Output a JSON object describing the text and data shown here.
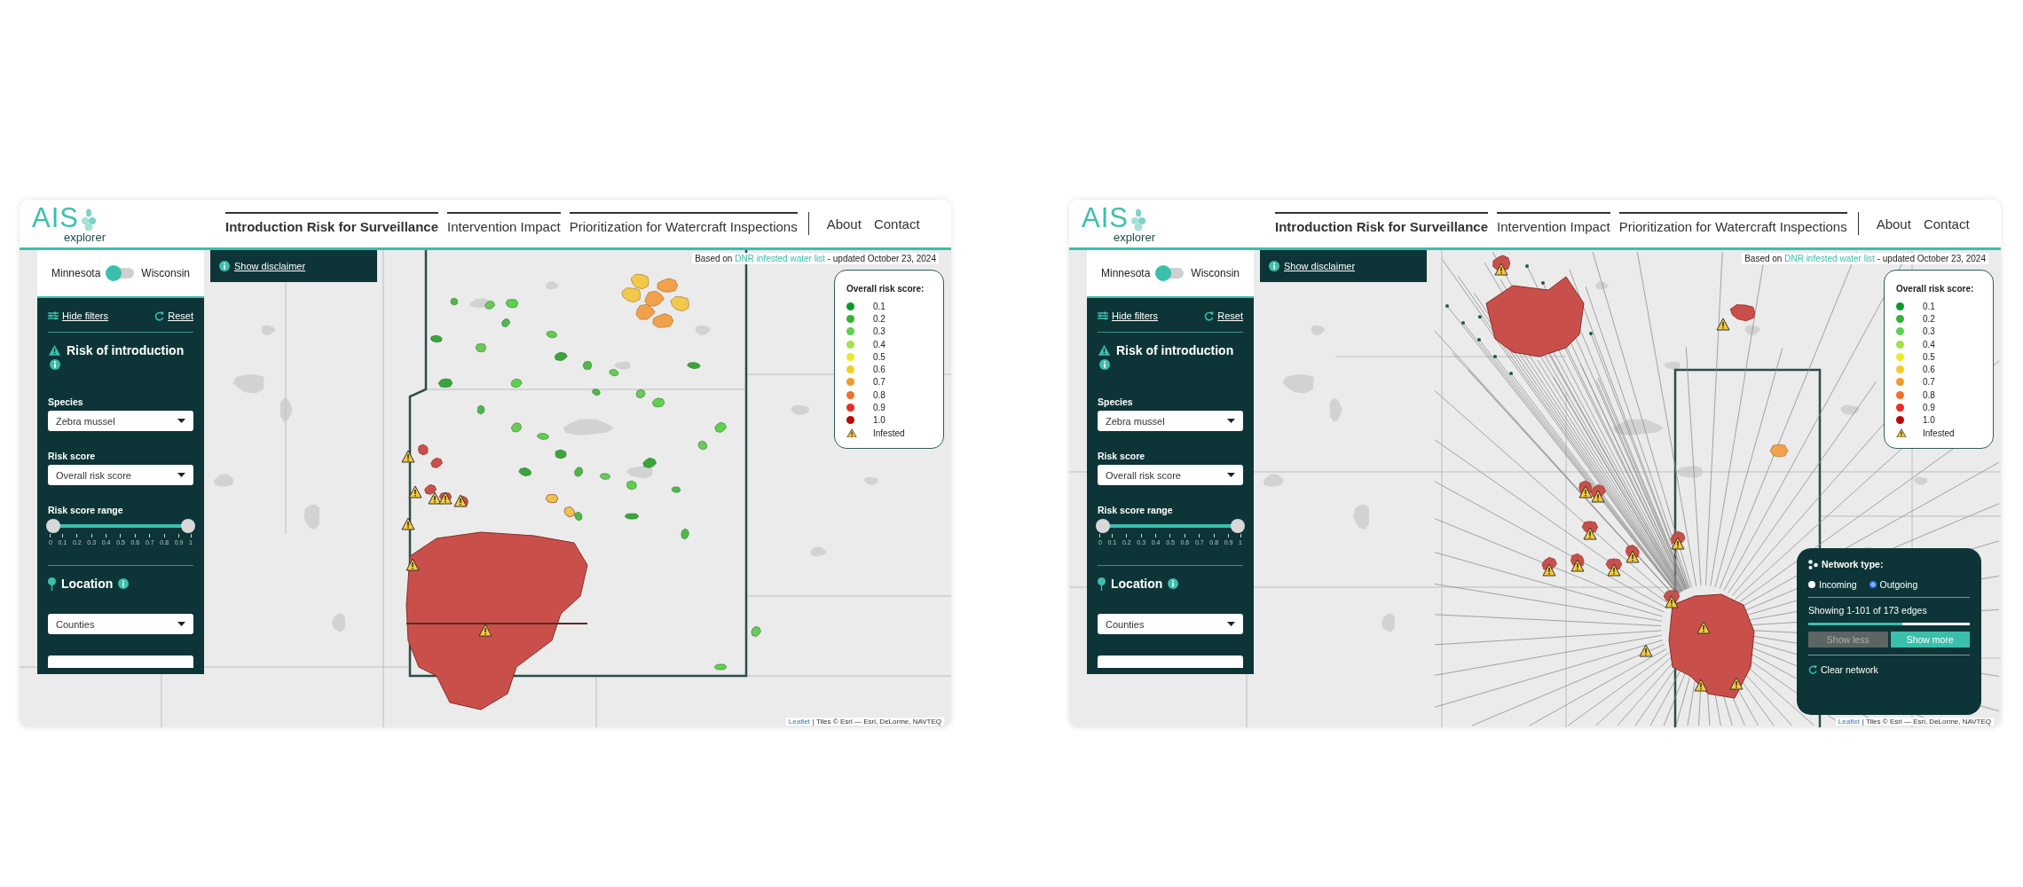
{
  "windows": [
    {
      "logo": {
        "title": "AIS",
        "subtitle": "explorer"
      },
      "nav": [
        {
          "label": "Introduction Risk for Surveillance",
          "selected": true
        },
        {
          "label": "Intervention Impact",
          "selected": false
        },
        {
          "label": "Prioritization for Watercraft Inspections",
          "selected": false
        }
      ],
      "links": [
        "About",
        "Contact"
      ],
      "state_toggle": {
        "left": "Minnesota",
        "right": "Wisconsin",
        "right_selected": false
      },
      "disclaimer": "Show disclaimer",
      "source": {
        "prefix": "Based on ",
        "link": "DNR infested water list",
        "suffix": " - updated October 23, 2024"
      },
      "filters": {
        "hide": "Hide filters",
        "reset": "Reset",
        "title": "Risk of introduction",
        "fields": [
          {
            "label": "Species",
            "value": "Zebra mussel"
          },
          {
            "label": "Risk score",
            "value": "Overall risk score"
          }
        ],
        "range": {
          "label": "Risk score range",
          "thumbs": [
            {
              "level": 0
            },
            {
              "level": 1
            }
          ],
          "ticks": [
            "0",
            "0.1",
            "0.2",
            "0.3",
            "0.4",
            "0.5",
            "0.6",
            "0.7",
            "0.8",
            "0.9",
            "1"
          ]
        },
        "location": {
          "title": "Location",
          "value": "Counties"
        }
      },
      "map": {
        "kind": "risk"
      },
      "legend": {
        "title": "Overall risk score:",
        "items": [
          {
            "kind": "score",
            "label": "0.1",
            "color": "#089c2c"
          },
          {
            "kind": "score",
            "label": "0.2",
            "color": "#35b233"
          },
          {
            "kind": "score",
            "label": "0.3",
            "color": "#5fcf4f"
          },
          {
            "kind": "score",
            "label": "0.4",
            "color": "#a3e04a"
          },
          {
            "kind": "score",
            "label": "0.5",
            "color": "#ece82a"
          },
          {
            "kind": "score",
            "label": "0.6",
            "color": "#f0cd2a"
          },
          {
            "kind": "score",
            "label": "0.7",
            "color": "#f29a2a"
          },
          {
            "kind": "score",
            "label": "0.8",
            "color": "#f0702a"
          },
          {
            "kind": "score",
            "label": "0.9",
            "color": "#ee2a2a"
          },
          {
            "kind": "score",
            "label": "1.0",
            "color": "#b80808"
          },
          {
            "kind": "infested",
            "label": "Infested"
          }
        ]
      },
      "attribution": {
        "link": "Leaflet",
        "text": "| Tiles © Esri — Esri, DeLorme, NAVTEQ"
      }
    },
    {
      "logo": {
        "title": "AIS",
        "subtitle": "explorer"
      },
      "nav": [
        {
          "label": "Introduction Risk for Surveillance",
          "selected": true
        },
        {
          "label": "Intervention Impact",
          "selected": false
        },
        {
          "label": "Prioritization for Watercraft Inspections",
          "selected": false
        }
      ],
      "links": [
        "About",
        "Contact"
      ],
      "state_toggle": {
        "left": "Minnesota",
        "right": "Wisconsin",
        "right_selected": false
      },
      "disclaimer": "Show disclaimer",
      "source": {
        "prefix": "Based on ",
        "link": "DNR infested water list",
        "suffix": " - updated October 23, 2024"
      },
      "filters": {
        "hide": "Hide filters",
        "reset": "Reset",
        "title": "Risk of introduction",
        "fields": [
          {
            "label": "Species",
            "value": "Zebra mussel"
          },
          {
            "label": "Risk score",
            "value": "Overall risk score"
          }
        ],
        "range": {
          "label": "Risk score range",
          "thumbs": [
            {
              "level": 0
            },
            {
              "level": 1
            }
          ],
          "ticks": [
            "0",
            "0.1",
            "0.2",
            "0.3",
            "0.4",
            "0.5",
            "0.6",
            "0.7",
            "0.8",
            "0.9",
            "1"
          ]
        },
        "location": {
          "title": "Location",
          "value": "Counties"
        }
      },
      "map": {
        "kind": "network"
      },
      "legend": {
        "title": "Overall risk score:",
        "items": [
          {
            "kind": "score",
            "label": "0.1",
            "color": "#089c2c"
          },
          {
            "kind": "score",
            "label": "0.2",
            "color": "#35b233"
          },
          {
            "kind": "score",
            "label": "0.3",
            "color": "#5fcf4f"
          },
          {
            "kind": "score",
            "label": "0.4",
            "color": "#a3e04a"
          },
          {
            "kind": "score",
            "label": "0.5",
            "color": "#ece82a"
          },
          {
            "kind": "score",
            "label": "0.6",
            "color": "#f0cd2a"
          },
          {
            "kind": "score",
            "label": "0.7",
            "color": "#f29a2a"
          },
          {
            "kind": "score",
            "label": "0.8",
            "color": "#f0702a"
          },
          {
            "kind": "score",
            "label": "0.9",
            "color": "#ee2a2a"
          },
          {
            "kind": "score",
            "label": "1.0",
            "color": "#b80808"
          },
          {
            "kind": "infested",
            "label": "Infested"
          }
        ]
      },
      "network_panel": {
        "title": "Network type:",
        "options": [
          {
            "label": "Incoming",
            "selected": false
          },
          {
            "label": "Outgoing",
            "selected": true
          }
        ],
        "status": "Showing 1-101 of 173 edges",
        "progress": {
          "level": 0.585
        },
        "buttons": [
          {
            "label": "Show less",
            "disabled": true
          },
          {
            "label": "Show more",
            "disabled": false
          }
        ],
        "clear": "Clear network"
      },
      "attribution": {
        "link": "Leaflet",
        "text": "| Tiles © Esri — Esri, DeLorme, NAVTEQ"
      }
    }
  ]
}
